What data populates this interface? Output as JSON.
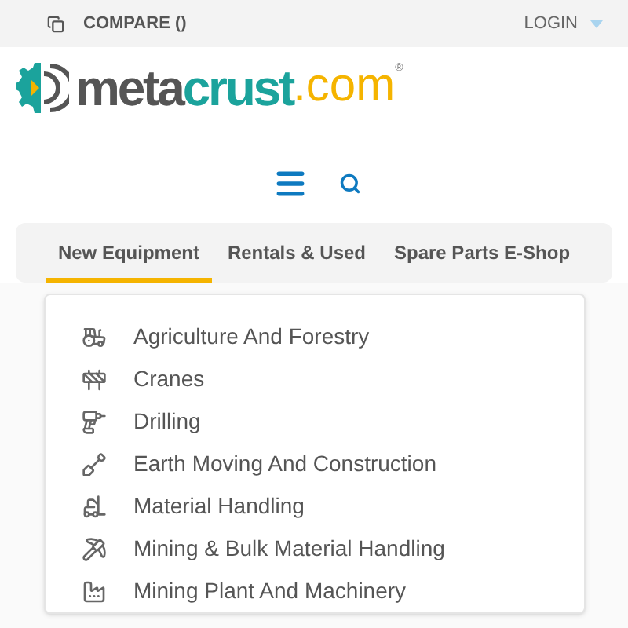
{
  "top_bar": {
    "compare": "COMPARE ()",
    "login": "LOGIN"
  },
  "logo": {
    "part_1": "meta",
    "part_2": "crust",
    "part_3": ".com",
    "mark": "®"
  },
  "tabs": [
    {
      "label": "New Equipment",
      "selected": true
    },
    {
      "label": "Rentals & Used",
      "selected": false
    },
    {
      "label": "Spare Parts E-Shop",
      "selected": false
    }
  ],
  "categories": [
    {
      "label": "Agriculture And Forestry"
    },
    {
      "label": "Cranes"
    },
    {
      "label": "Drilling"
    },
    {
      "label": "Earth Moving And Construction"
    },
    {
      "label": "Material Handling"
    },
    {
      "label": "Mining & Bulk Material Handling"
    },
    {
      "label": "Mining Plant And Machinery"
    }
  ]
}
